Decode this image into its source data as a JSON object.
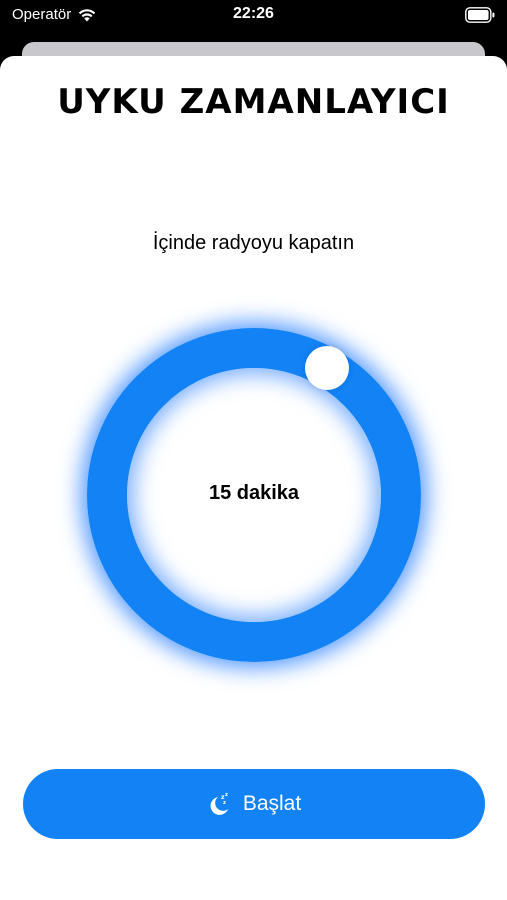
{
  "status_bar": {
    "carrier": "Operatör",
    "time": "22:26",
    "icons": [
      "wifi-icon",
      "battery-icon"
    ]
  },
  "sheet": {
    "title": "UYKU ZAMANLAYICI",
    "subtitle": "İçinde radyoyu kapatın"
  },
  "timer_dial": {
    "value_label": "15 dakika",
    "value_minutes": 15,
    "ring_color": "#1282f5",
    "knob_color": "#ffffff"
  },
  "start_button": {
    "label": "Başlat",
    "icon": "moon-zzz-icon",
    "color": "#1282f5"
  }
}
